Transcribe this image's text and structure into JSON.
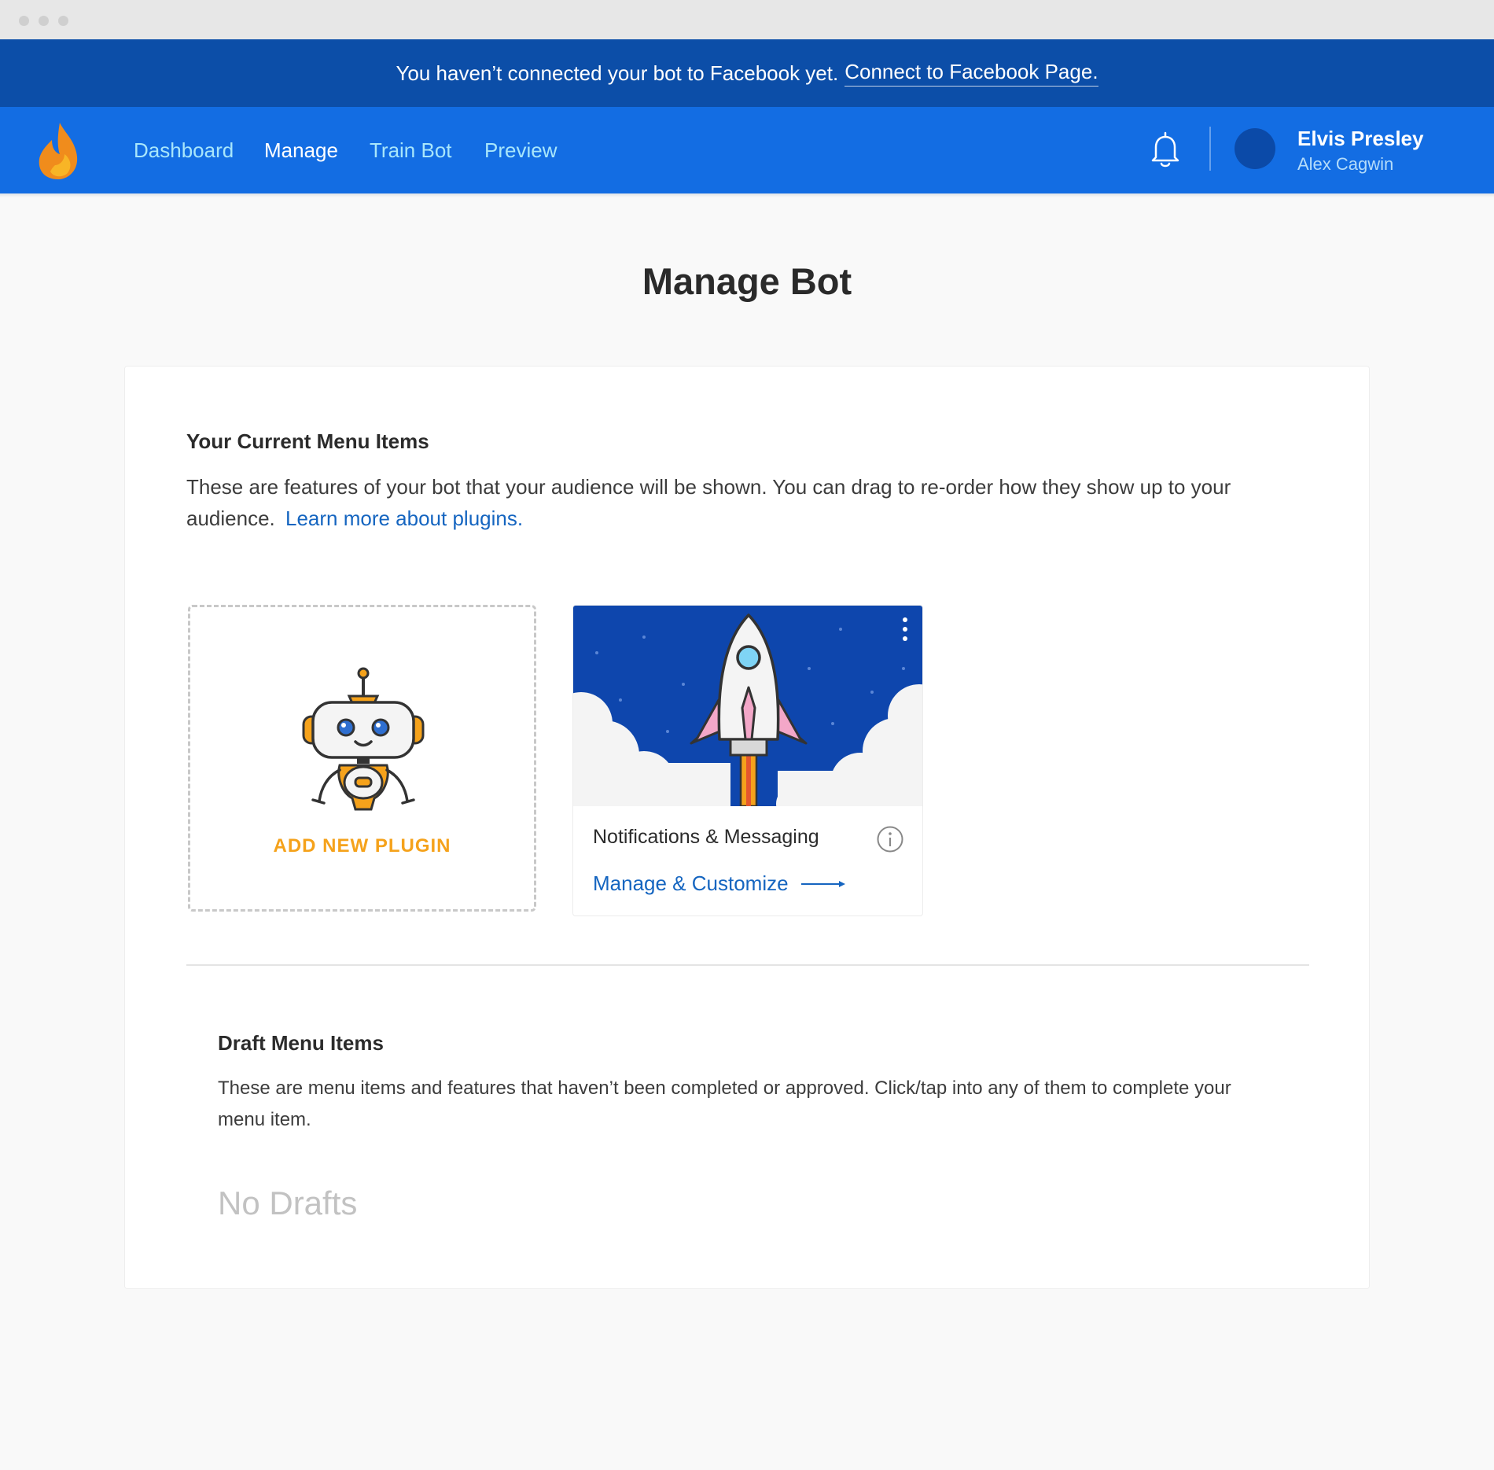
{
  "banner": {
    "message": "You haven’t connected your bot to Facebook yet.",
    "link_label": "Connect to Facebook Page."
  },
  "nav": {
    "items": [
      {
        "label": "Dashboard"
      },
      {
        "label": "Manage"
      },
      {
        "label": "Train Bot"
      },
      {
        "label": "Preview"
      }
    ],
    "active": "Manage",
    "icons": [
      "flame-logo-icon",
      "bell-icon"
    ],
    "user": {
      "name": "Elvis Presley",
      "subtitle": "Alex Cagwin"
    }
  },
  "page": {
    "title": "Manage Bot"
  },
  "current_menu": {
    "title": "Your Current Menu Items",
    "description": "These are features of your bot that your audience will be shown. You can drag to re-order how they show up to your audience.",
    "learn_more": "Learn more about plugins.",
    "add_plugin_label": "ADD NEW PLUGIN",
    "plugins": [
      {
        "name": "Notifications & Messaging",
        "action": "Manage & Customize",
        "icon": "rocket-icon"
      }
    ]
  },
  "drafts": {
    "title": "Draft Menu Items",
    "description": "These are menu items and features that haven’t been completed or approved. Click/tap into any of them to complete your menu item.",
    "empty_label": "No Drafts"
  },
  "colors": {
    "banner": "#0c4ea8",
    "nav": "#136de3",
    "link": "#1565c0",
    "accent_orange": "#f5a21b",
    "rocket_bg": "#0e46ad"
  }
}
